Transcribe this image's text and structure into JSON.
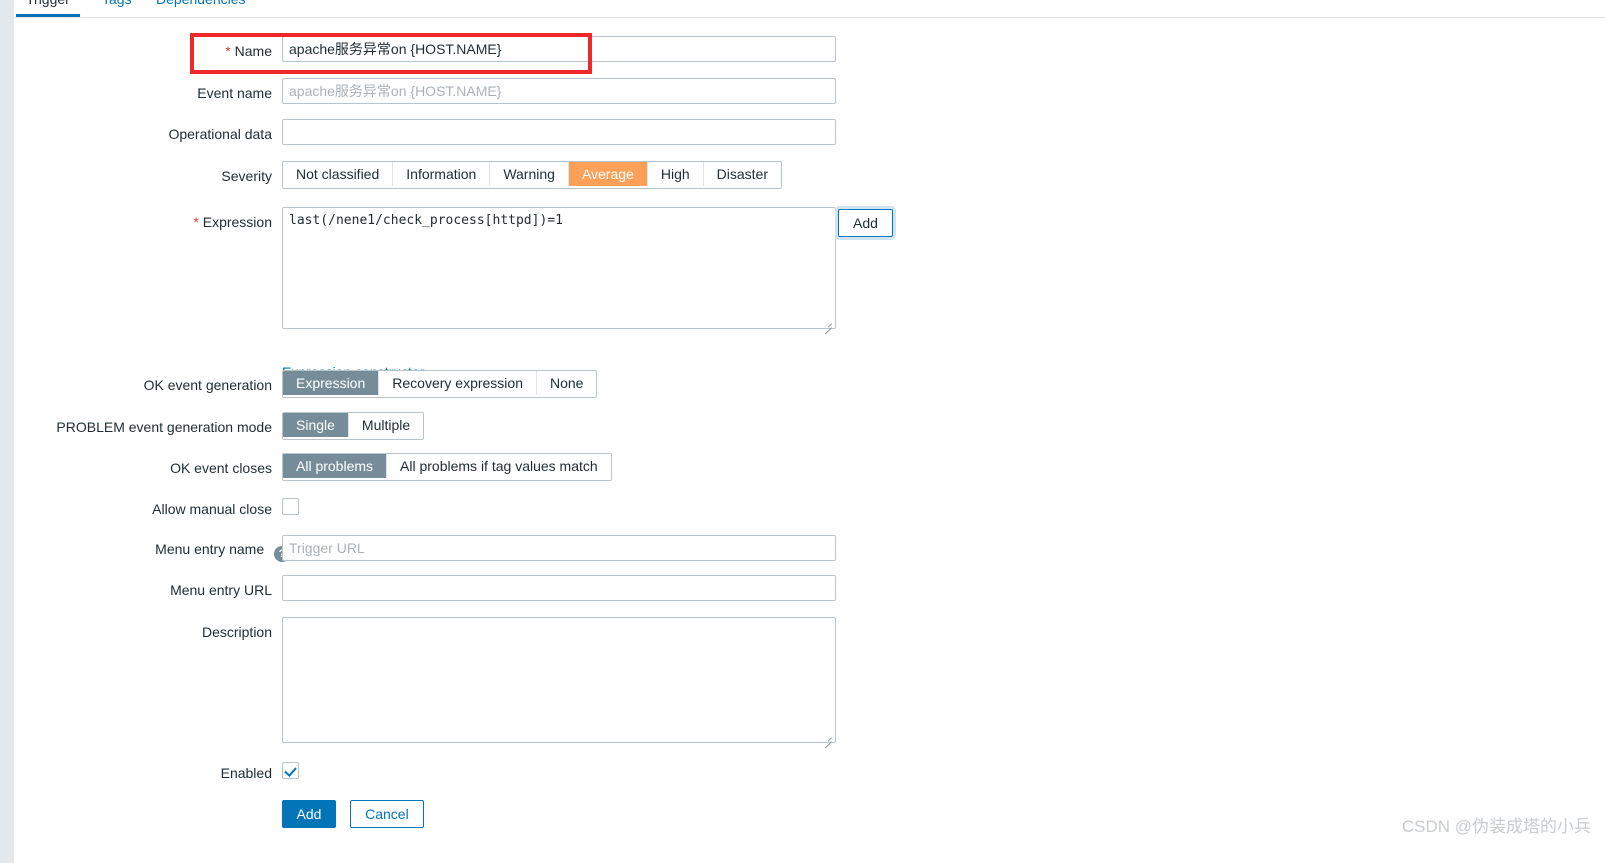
{
  "tabs": [
    {
      "label": "Trigger",
      "active": true
    },
    {
      "label": "Tags",
      "active": false
    },
    {
      "label": "Dependencies",
      "active": false
    }
  ],
  "form": {
    "name": {
      "label": "Name",
      "required": "*",
      "value": "apache服务异常on {HOST.NAME}",
      "placeholder": ""
    },
    "event_name": {
      "label": "Event name",
      "value": "",
      "placeholder": "apache服务异常on {HOST.NAME}"
    },
    "operational_data": {
      "label": "Operational data",
      "value": "",
      "placeholder": ""
    },
    "severity": {
      "label": "Severity",
      "options": [
        "Not classified",
        "Information",
        "Warning",
        "Average",
        "High",
        "Disaster"
      ],
      "selected": "Average",
      "selected_color": "#ffa059"
    },
    "expression": {
      "label": "Expression",
      "required": "*",
      "value": "last(/nene1/check_process[httpd])=1",
      "add_button": "Add",
      "constructor_link": "Expression constructor"
    },
    "ok_event_generation": {
      "label": "OK event generation",
      "options": [
        "Expression",
        "Recovery expression",
        "None"
      ],
      "selected": "Expression"
    },
    "problem_event_generation_mode": {
      "label": "PROBLEM event generation mode",
      "options": [
        "Single",
        "Multiple"
      ],
      "selected": "Single"
    },
    "ok_event_closes": {
      "label": "OK event closes",
      "options": [
        "All problems",
        "All problems if tag values match"
      ],
      "selected": "All problems"
    },
    "allow_manual_close": {
      "label": "Allow manual close",
      "checked": false
    },
    "menu_entry_name": {
      "label": "Menu entry name",
      "help_icon": "question-mark",
      "value": "",
      "placeholder": "Trigger URL"
    },
    "menu_entry_url": {
      "label": "Menu entry URL",
      "value": "",
      "placeholder": ""
    },
    "description": {
      "label": "Description",
      "value": "",
      "placeholder": ""
    },
    "enabled": {
      "label": "Enabled",
      "checked": true
    }
  },
  "footer": {
    "submit_label": "Add",
    "cancel_label": "Cancel"
  },
  "watermark": "CSDN @伪装成塔的小兵",
  "colors": {
    "accent": "#0275b8",
    "selected_segment": "#768d99",
    "severity_average": "#ffa059",
    "annotation": "#ef2929",
    "required": "#d94436"
  }
}
